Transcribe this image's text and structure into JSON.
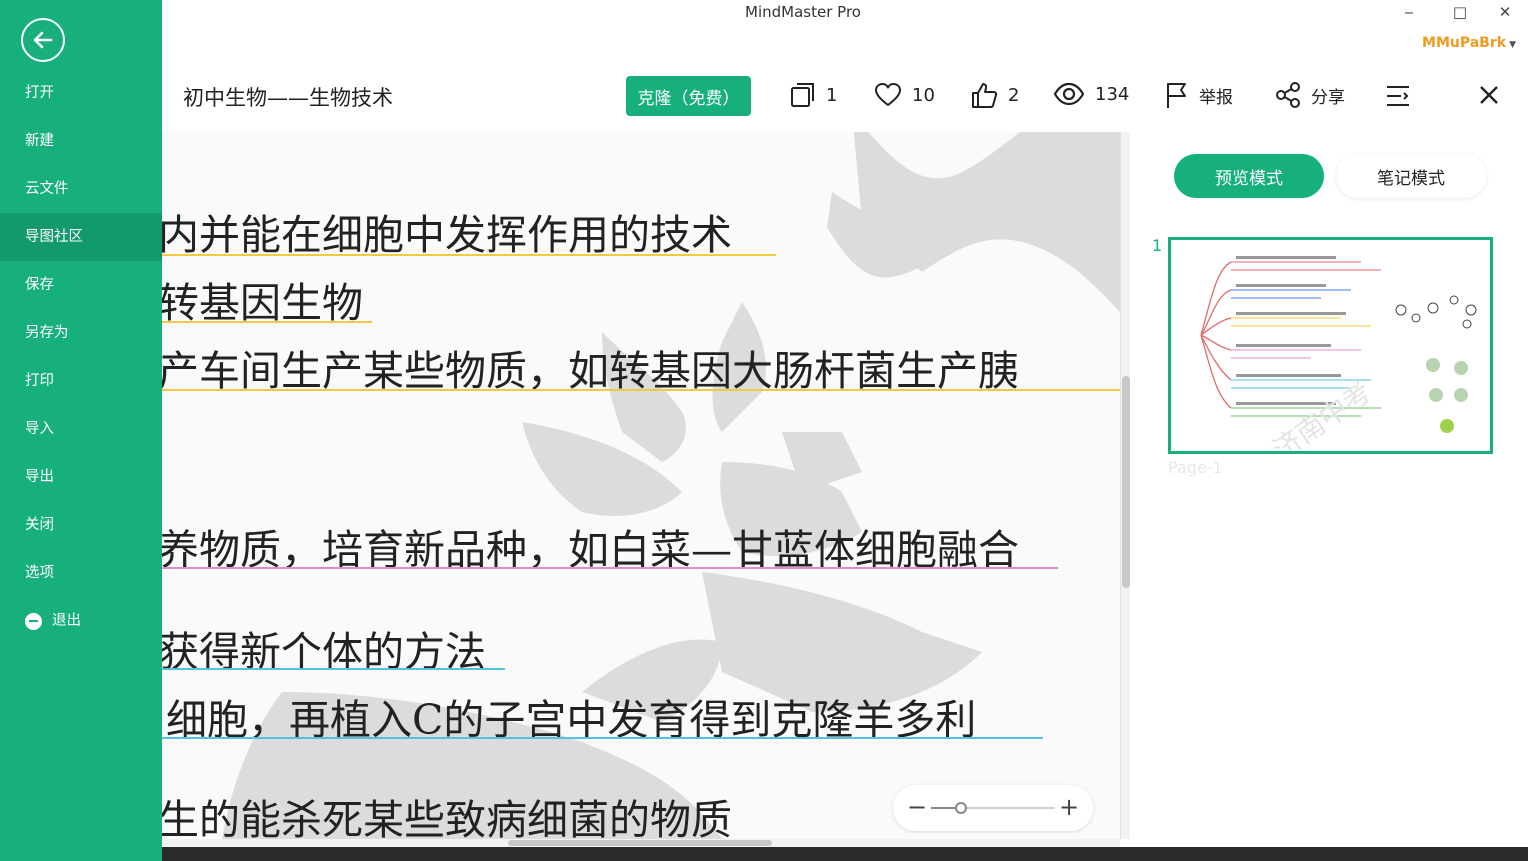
{
  "app": {
    "title": "MindMaster Pro",
    "user": "MMuPaBrk"
  },
  "window_controls": {
    "minimize": "‒",
    "maximize": "□",
    "close": "✕"
  },
  "sidebar": {
    "items": [
      {
        "label": "打开"
      },
      {
        "label": "新建"
      },
      {
        "label": "云文件"
      },
      {
        "label": "导图社区",
        "active": true
      },
      {
        "label": "保存"
      },
      {
        "label": "另存为"
      },
      {
        "label": "打印"
      },
      {
        "label": "导入"
      },
      {
        "label": "导出"
      },
      {
        "label": "关闭"
      },
      {
        "label": "选项"
      },
      {
        "label": "退出",
        "icon": "minus-circle-icon"
      }
    ]
  },
  "header": {
    "doc_title": "初中生物——生物技术",
    "clone_label": "克隆（免费）",
    "pages_count": "1",
    "likes_count": "10",
    "thumbs_count": "2",
    "views_count": "134",
    "report_label": "举报",
    "share_label": "分享"
  },
  "canvas": {
    "lines": [
      {
        "text": "内并能在细胞中发挥作用的技术",
        "color": "#f5c842"
      },
      {
        "text": "转基因生物",
        "color": "#f5c842"
      },
      {
        "text": "产车间生产某些物质，如转基因大肠杆菌生产胰",
        "color": "#f5c842"
      },
      {
        "text": "养物质，培育新品种，如白菜—甘蓝体细胞融合",
        "color": "#e68ad0"
      },
      {
        "text": "获得新个体的方法",
        "color": "#4fc3e0"
      },
      {
        "text": "细胞，再植入C的子宫中发育得到克隆羊多利",
        "color": "#4fc3e0"
      },
      {
        "text": "生的能杀死某些致病细菌的物质",
        "color": "#4fc3e0"
      }
    ],
    "zoom": {
      "minus": "−",
      "plus": "+",
      "level": 0.24
    }
  },
  "right_panel": {
    "tab_preview": "预览模式",
    "tab_notes": "笔记模式",
    "page_number": "1",
    "page_label": "Page-1"
  },
  "colors": {
    "accent": "#17b07a",
    "user": "#f29c1f"
  }
}
